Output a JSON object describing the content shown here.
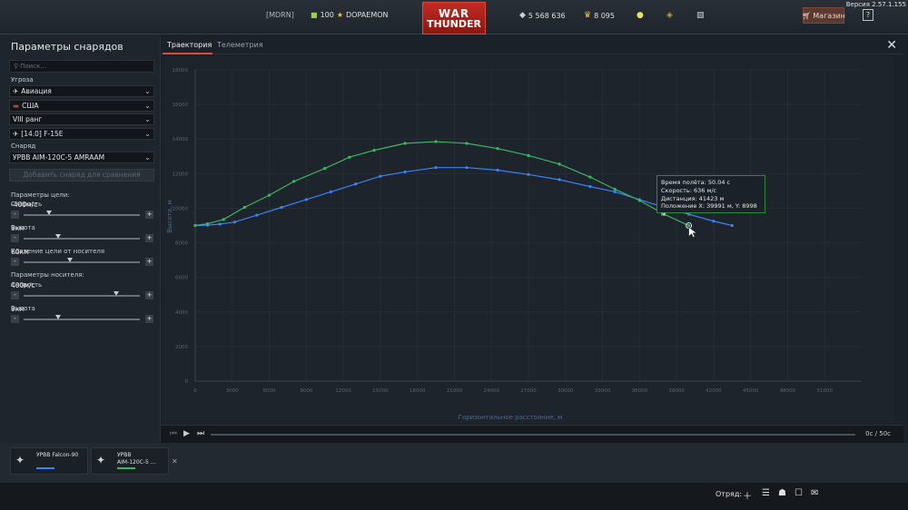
{
  "topbar": {
    "version": "Версия 2.57.1.155",
    "clan": "[MDRN]",
    "level": "100",
    "nickname": "DOPAEMON",
    "logo_line1": "WAR",
    "logo_line2": "THUNDER",
    "silver_lions": "5 568 636",
    "golden_eagles": "8 095",
    "shop_label": "Магазин",
    "help_label": "?"
  },
  "left_panel": {
    "title": "Параметры снарядов",
    "search_placeholder": "Поиск...",
    "threat_label": "Угроза",
    "threat_type": "Авиация",
    "country": "США",
    "rank": "VIII ранг",
    "vehicle": "[14.0] F-15E",
    "shell_label": "Снаряд",
    "shell": "УРВВ AIM-120C-5 AMRAAM",
    "add_button": "Добавить снаряд для сравнения",
    "target_params_label": "Параметры цели:",
    "target_speed_label": "Скорость",
    "target_speed_value": "-400м/с",
    "target_speed_fraction": 0.22,
    "target_alt_label": "Высота",
    "target_alt_value": "9км",
    "target_alt_fraction": 0.3,
    "distance_label": "Удаление цели от носителя",
    "distance_value": "60км",
    "distance_fraction": 0.4,
    "carrier_params_label": "Параметры носителя:",
    "carrier_speed_label": "Скорость",
    "carrier_speed_value": "400м/с",
    "carrier_speed_fraction": 0.8,
    "carrier_alt_label": "Высота",
    "carrier_alt_value": "9км",
    "carrier_alt_fraction": 0.3,
    "minus": "-",
    "plus": "+"
  },
  "tabs": {
    "trajectory": "Траектория",
    "telemetry": "Телеметрия"
  },
  "tooltip": {
    "line1": "Время полёта: 50.04 с",
    "line2": "Скорость: 636 м/с",
    "line3": "Дистанция: 41423 м",
    "line4": "Положение X: 39991 м, Y: 8998 м"
  },
  "playbar": {
    "time": "0с / 50с"
  },
  "cards": [
    {
      "name": "УРВВ Falcon-90",
      "color": "#3b82f6"
    },
    {
      "name_line1": "УРВВ",
      "name_line2": "AIM-120C-5 ...",
      "color": "#3cb860"
    }
  ],
  "bottombar": {
    "squad_label": "Отряд:"
  },
  "colors": {
    "series_blue": "#3b82f6",
    "series_green": "#3cb860",
    "accent_red": "#e04a3a"
  },
  "chart_data": {
    "type": "line",
    "xlabel": "Горизонтальное расстояние, м",
    "ylabel": "Высота, м",
    "xlim": [
      0,
      54000
    ],
    "ylim": [
      0,
      18000
    ],
    "xticks": [
      0,
      3000,
      6000,
      9000,
      12000,
      15000,
      18000,
      21000,
      24000,
      27000,
      30000,
      33000,
      36000,
      39000,
      42000,
      45000,
      48000,
      51000
    ],
    "xtick_labels": [
      "0",
      "3000",
      "6000",
      "9000",
      "12000",
      "15000",
      "18000",
      "21000",
      "24000",
      "27000",
      "30000",
      "33000",
      "36000",
      "39000",
      "42000",
      "45000",
      "48000",
      "51000"
    ],
    "yticks": [
      0,
      2000,
      4000,
      6000,
      8000,
      10000,
      12000,
      14000,
      16000,
      18000
    ],
    "ytick_labels": [
      "0",
      "2000",
      "4000",
      "6000",
      "8000",
      "10000",
      "12000",
      "14000",
      "16000",
      "18000"
    ],
    "grid": true,
    "series": [
      {
        "name": "УРВВ Falcon-90",
        "color": "#3b82f6",
        "x": [
          0,
          1000,
          2000,
          3200,
          5000,
          7000,
          9000,
          11000,
          13000,
          15000,
          17000,
          19500,
          22000,
          24500,
          27000,
          29500,
          32000,
          34000,
          36000,
          38000,
          40000,
          42000,
          43500
        ],
        "y": [
          9000,
          9020,
          9080,
          9200,
          9600,
          10050,
          10500,
          10950,
          11400,
          11850,
          12100,
          12350,
          12350,
          12200,
          11950,
          11650,
          11250,
          10950,
          10500,
          10050,
          9650,
          9250,
          9000
        ]
      },
      {
        "name": "УРВВ AIM-120C-5 AMRAAM",
        "color": "#3cb860",
        "x": [
          0,
          1000,
          2300,
          4000,
          6000,
          8000,
          10500,
          12500,
          14500,
          17000,
          19500,
          22000,
          24500,
          27000,
          29500,
          32000,
          34000,
          36000,
          38000,
          39991
        ],
        "y": [
          9000,
          9100,
          9350,
          10050,
          10750,
          11550,
          12300,
          12950,
          13350,
          13750,
          13850,
          13750,
          13450,
          13050,
          12550,
          11800,
          11100,
          10450,
          9650,
          8998
        ]
      }
    ],
    "annotations": [
      "Время полёта: 50.04 с",
      "Скорость: 636 м/с",
      "Дистанция: 41423 м",
      "Положение X: 39991 м, Y: 8998 м"
    ]
  }
}
